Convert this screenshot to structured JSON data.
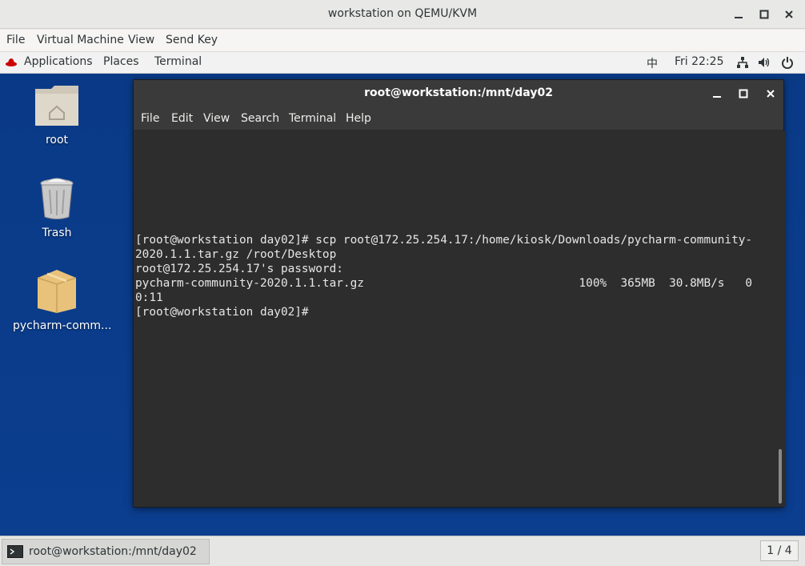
{
  "vm_window": {
    "title": "workstation on QEMU/KVM",
    "menu": [
      "File",
      "Virtual Machine",
      "View",
      "Send Key"
    ]
  },
  "gnome_topbar": {
    "applications": "Applications",
    "places": "Places",
    "terminal": "Terminal",
    "input_method": "中",
    "clock": "Fri 22:25"
  },
  "desktop_icons": [
    {
      "label": "root",
      "icon": "home-folder-icon"
    },
    {
      "label": "Trash",
      "icon": "trash-icon"
    },
    {
      "label": "pycharm-comm...",
      "icon": "package-icon"
    }
  ],
  "terminal": {
    "title": "root@workstation:/mnt/day02",
    "menu": [
      "File",
      "Edit",
      "View",
      "Search",
      "Terminal",
      "Help"
    ],
    "lines": [
      "",
      "",
      "",
      "",
      "",
      "",
      "",
      "[root@workstation day02]# scp root@172.25.254.17:/home/kiosk/Downloads/pycharm-community-",
      "2020.1.1.tar.gz /root/Desktop",
      "root@172.25.254.17's password:",
      "pycharm-community-2020.1.1.tar.gz                               100%  365MB  30.8MB/s   0",
      "0:11",
      "[root@workstation day02]# "
    ]
  },
  "taskbar": {
    "window_label": "root@workstation:/mnt/day02",
    "workspace": "1 / 4"
  }
}
